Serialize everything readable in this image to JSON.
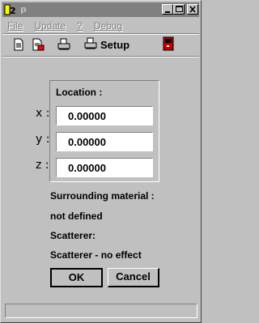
{
  "window": {
    "title": "p",
    "icons": {
      "app": "app-icon",
      "minimize": "minimize-icon",
      "maximize": "maximize-icon",
      "close": "close-icon"
    }
  },
  "menu": {
    "items": [
      "File",
      "Update",
      "?",
      "Debug"
    ]
  },
  "toolbar": {
    "icons": [
      "new-document-icon",
      "open-document-icon",
      "print-icon",
      "setup-icon",
      "exit-door-icon"
    ],
    "setup_label": "Setup"
  },
  "location": {
    "title": "Location :",
    "axes": [
      {
        "label": "x :",
        "value": "0.00000"
      },
      {
        "label": "y :",
        "value": "0.00000"
      },
      {
        "label": "z :",
        "value": "0.00000"
      }
    ]
  },
  "info": {
    "surrounding_label": "Surrounding material :",
    "surrounding_value": "not defined",
    "scatterer_label": "Scatterer:",
    "scatterer_value": "Scatterer - no effect"
  },
  "buttons": {
    "ok": "OK",
    "cancel": "Cancel"
  },
  "colors": {
    "titlebar": "#808080",
    "face": "#c0c0c0",
    "door": "#c00000"
  }
}
